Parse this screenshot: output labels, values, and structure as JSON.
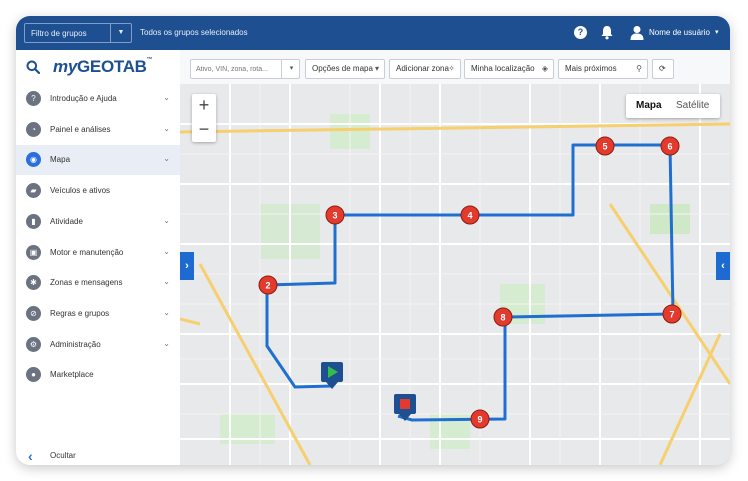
{
  "header": {
    "group_filter_label": "Filtro de grupos",
    "groups_selected_text": "Todos os grupos selecionados",
    "help_label": "?",
    "user_name": "Nome de usuário",
    "user_caret": "▾",
    "color": "#1d4f91"
  },
  "sidebar": {
    "logo_my": "my",
    "logo_geotab": "GEOTAB",
    "logo_tm": "™",
    "items": [
      {
        "label": "Introdução e Ajuda",
        "icon": "help-circle-icon",
        "glyph": "?",
        "active": false,
        "chevron": true
      },
      {
        "label": "Painel e análises",
        "icon": "pie-chart-icon",
        "glyph": "◔",
        "active": false,
        "chevron": true
      },
      {
        "label": "Mapa",
        "icon": "map-icon",
        "glyph": "◉",
        "active": true,
        "chevron": true
      },
      {
        "label": "Veículos e ativos",
        "icon": "truck-icon",
        "glyph": "▰",
        "active": false,
        "chevron": false
      },
      {
        "label": "Atividade",
        "icon": "activity-chart-icon",
        "glyph": "▮",
        "active": false,
        "chevron": true
      },
      {
        "label": "Motor e manutenção",
        "icon": "engine-icon",
        "glyph": "▣",
        "active": false,
        "chevron": true
      },
      {
        "label": "Zonas e mensagens",
        "icon": "puzzle-icon",
        "glyph": "✱",
        "active": false,
        "chevron": true
      },
      {
        "label": "Regras e grupos",
        "icon": "rules-icon",
        "glyph": "⊘",
        "active": false,
        "chevron": true
      },
      {
        "label": "Administração",
        "icon": "gear-icon",
        "glyph": "⚙",
        "active": false,
        "chevron": true
      },
      {
        "label": "Marketplace",
        "icon": "marketplace-pin-icon",
        "glyph": "●",
        "active": false,
        "chevron": false
      }
    ],
    "chevron_glyph": "⌄",
    "hide_label": "Ocultar",
    "hide_glyph": "‹"
  },
  "toolbar": {
    "search_placeholder": "Ativo, VIN, zona, rota...",
    "search_caret": "▾",
    "map_options_label": "Opções de mapa",
    "map_options_icon": "▾",
    "add_zone_label": "Adicionar zona",
    "add_zone_icon": "✧",
    "my_location_label": "Minha localização",
    "my_location_icon": "◈",
    "nearest_label": "Mais próximos",
    "nearest_icon": "⚲",
    "refresh_icon": "⟳"
  },
  "map": {
    "zoom_in": "+",
    "zoom_out": "−",
    "type_map": "Mapa",
    "type_satellite": "Satélite",
    "left_tab_glyph": "›",
    "right_tab_glyph": "‹",
    "route_color": "#1f6fd1",
    "stop_color": "#e23b2e",
    "start_marker_color": "#2fbf4a",
    "end_marker_color": "#e23b2e",
    "stops": [
      "2",
      "3",
      "4",
      "5",
      "6",
      "7",
      "8",
      "9"
    ]
  }
}
